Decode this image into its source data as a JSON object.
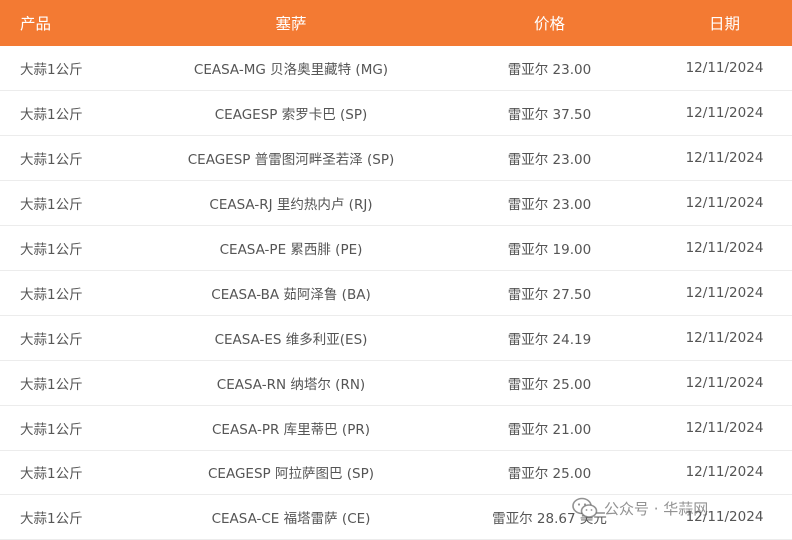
{
  "table": {
    "headers": [
      "产品",
      "塞萨",
      "价格",
      "日期"
    ],
    "rows": [
      [
        "大蒜1公斤",
        "CEASA-MG 贝洛奥里藏特 (MG)",
        "雷亚尔 23.00",
        "12/11/2024"
      ],
      [
        "大蒜1公斤",
        "CEAGESP 索罗卡巴 (SP)",
        "雷亚尔 37.50",
        "12/11/2024"
      ],
      [
        "大蒜1公斤",
        "CEAGESP 普雷图河畔圣若泽 (SP)",
        "雷亚尔 23.00",
        "12/11/2024"
      ],
      [
        "大蒜1公斤",
        "CEASA-RJ 里约热内卢 (RJ)",
        "雷亚尔 23.00",
        "12/11/2024"
      ],
      [
        "大蒜1公斤",
        "CEASA-PE 累西腓 (PE)",
        "雷亚尔 19.00",
        "12/11/2024"
      ],
      [
        "大蒜1公斤",
        "CEASA-BA 茹阿泽鲁 (BA)",
        "雷亚尔 27.50",
        "12/11/2024"
      ],
      [
        "大蒜1公斤",
        "CEASA-ES 维多利亚(ES)",
        "雷亚尔 24.19",
        "12/11/2024"
      ],
      [
        "大蒜1公斤",
        "CEASA-RN 纳塔尔 (RN)",
        "雷亚尔 25.00",
        "12/11/2024"
      ],
      [
        "大蒜1公斤",
        "CEASA-PR 库里蒂巴 (PR)",
        "雷亚尔 21.00",
        "12/11/2024"
      ],
      [
        "大蒜1公斤",
        "CEAGESP 阿拉萨图巴 (SP)",
        "雷亚尔 25.00",
        "12/11/2024"
      ],
      [
        "大蒜1公斤",
        "CEASA-CE 福塔雷萨 (CE)",
        "雷亚尔 28.67 美元",
        "12/11/2024"
      ]
    ]
  },
  "watermark": {
    "text": "公众号 · 华蒜网",
    "icon": "wechat-icon"
  },
  "colors": {
    "header_bg": "#f37a33",
    "header_text": "#ffffff",
    "cell_text": "#555555",
    "row_border": "#ececec"
  }
}
